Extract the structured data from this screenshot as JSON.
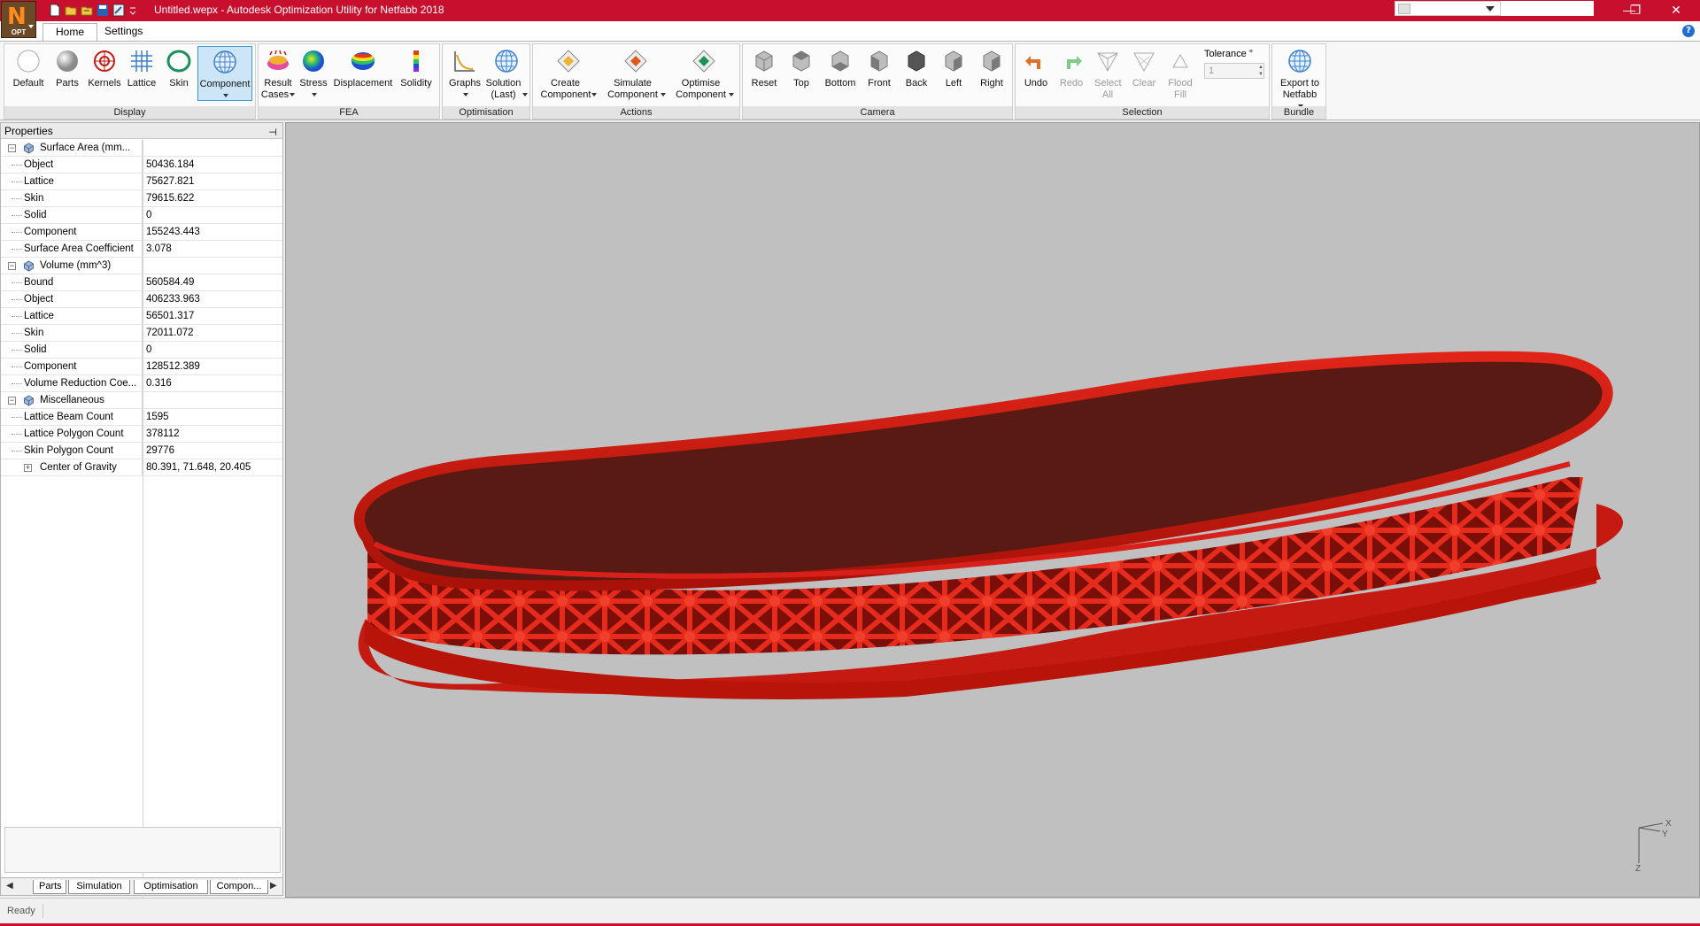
{
  "titlebar": {
    "title": "Untitled.wepx - Autodesk Optimization Utility for Netfabb 2018",
    "logo_text": "OPT",
    "minimize": "—",
    "restore": "❐",
    "close": "✕"
  },
  "menu": {
    "tabs": [
      "Home",
      "Settings"
    ],
    "help": "?"
  },
  "ribbon": {
    "display": {
      "label": "Display",
      "buttons": [
        "Default",
        "Parts",
        "Kernels",
        "Lattice",
        "Skin",
        "Component"
      ]
    },
    "fea": {
      "label": "FEA",
      "buttons": [
        "Result Cases",
        "Stress",
        "Displacement",
        "Solidity"
      ]
    },
    "optimisation": {
      "label": "Optimisation",
      "buttons": [
        "Graphs",
        "Solution (Last)"
      ]
    },
    "actions": {
      "label": "Actions",
      "buttons": [
        "Create Component",
        "Simulate Component",
        "Optimise Component"
      ]
    },
    "camera": {
      "label": "Camera",
      "buttons": [
        "Reset",
        "Top",
        "Bottom",
        "Front",
        "Back",
        "Left",
        "Right"
      ]
    },
    "selection": {
      "label": "Selection",
      "buttons": [
        "Undo",
        "Redo",
        "Select All",
        "Clear",
        "Flood Fill"
      ],
      "tolerance_label": "Tolerance °",
      "tolerance_value": "1"
    },
    "bundle": {
      "label": "Bundle",
      "buttons": [
        "Export to Netfabb"
      ]
    }
  },
  "properties": {
    "header": "Properties",
    "pin": "⊣",
    "rows": [
      {
        "name": "Surface Area (mm...",
        "value": "",
        "type": "cat"
      },
      {
        "name": "Object",
        "value": "50436.184"
      },
      {
        "name": "Lattice",
        "value": "75627.821"
      },
      {
        "name": "Skin",
        "value": "79615.622"
      },
      {
        "name": "Solid",
        "value": "0"
      },
      {
        "name": "Component",
        "value": "155243.443"
      },
      {
        "name": "Surface Area Coefficient",
        "value": "3.078"
      },
      {
        "name": "Volume (mm^3)",
        "value": "",
        "type": "cat"
      },
      {
        "name": "Bound",
        "value": "560584.49"
      },
      {
        "name": "Object",
        "value": "406233.963"
      },
      {
        "name": "Lattice",
        "value": "56501.317"
      },
      {
        "name": "Skin",
        "value": "72011.072"
      },
      {
        "name": "Solid",
        "value": "0"
      },
      {
        "name": "Component",
        "value": "128512.389"
      },
      {
        "name": "Volume Reduction Coe...",
        "value": "0.316"
      },
      {
        "name": "Miscellaneous",
        "value": "",
        "type": "cat"
      },
      {
        "name": "Lattice Beam Count",
        "value": "1595"
      },
      {
        "name": "Lattice Polygon Count",
        "value": "378112"
      },
      {
        "name": "Skin Polygon Count",
        "value": "29776"
      },
      {
        "name": "Center of Gravity",
        "value": "80.391, 71.648, 20.405",
        "type": "sub2"
      }
    ],
    "tabs": [
      "Parts",
      "Simulation",
      "Optimisation",
      "Compon..."
    ]
  },
  "viewport": {
    "axes": {
      "x": "X",
      "y": "Y",
      "z": "Z"
    },
    "model_color": "#c41a12",
    "background": "#c0c0c0"
  },
  "status": {
    "text": "Ready"
  },
  "colors": {
    "titlebar": "#c8102e",
    "accent": "#3c9ad9"
  }
}
